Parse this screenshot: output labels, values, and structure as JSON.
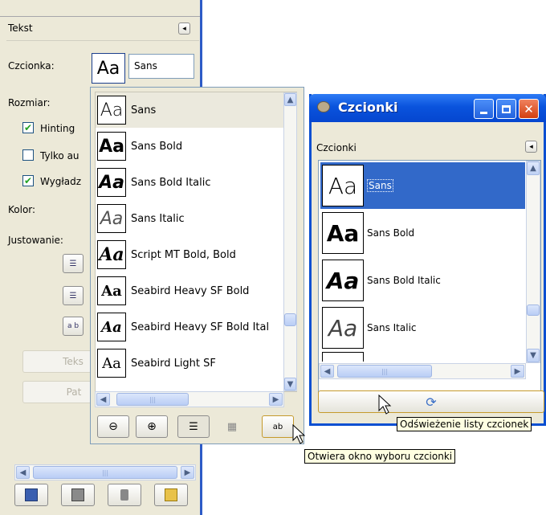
{
  "left_panel": {
    "title": "Tekst",
    "font_label": "Czcionka:",
    "font_preview": "Aa",
    "font_value": "Sans",
    "size_label": "Rozmiar:",
    "hinting_label": "Hinting",
    "autohint_label": "Tylko au",
    "antialias_label": "Wygładz",
    "color_label": "Kolor:",
    "justify_label": "Justowanie:",
    "text_button_label": "Teks",
    "path_button_label": "Pat"
  },
  "dropdown": {
    "fonts": [
      {
        "name": "Sans",
        "preview": "Aa"
      },
      {
        "name": "Sans Bold",
        "preview": "Aa"
      },
      {
        "name": "Sans Bold Italic",
        "preview": "Aa"
      },
      {
        "name": "Sans Italic",
        "preview": "Aa"
      },
      {
        "name": "Script MT Bold, Bold",
        "preview": "Aa"
      },
      {
        "name": "Seabird Heavy SF Bold",
        "preview": "Aa"
      },
      {
        "name": "Seabird Heavy SF Bold Ital",
        "preview": "Aa"
      },
      {
        "name": "Seabird Light SF",
        "preview": "Aa"
      }
    ],
    "tooltip": "Otwiera okno wyboru czcionki"
  },
  "fonts_window": {
    "title": "Czcionki",
    "tab_label": "Czcionki",
    "fonts": [
      {
        "name": "Sans",
        "preview": "Aa"
      },
      {
        "name": "Sans Bold",
        "preview": "Aa"
      },
      {
        "name": "Sans Bold Italic",
        "preview": "Aa"
      },
      {
        "name": "Sans Italic",
        "preview": "Aa"
      }
    ],
    "tooltip": "Odświeżenie listy czcionek"
  }
}
